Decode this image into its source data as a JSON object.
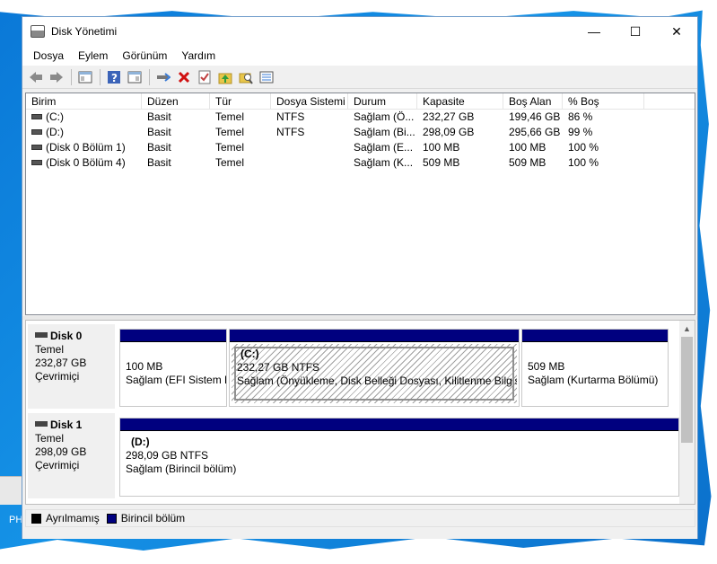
{
  "window": {
    "title": "Disk Yönetimi",
    "controls": {
      "minimize": "—",
      "maximize": "☐",
      "close": "✕"
    }
  },
  "menu": [
    "Dosya",
    "Eylem",
    "Görünüm",
    "Yardım"
  ],
  "toolbar_icons": [
    "back-arrow-icon",
    "forward-arrow-icon",
    "show-hide-tree-icon",
    "help-icon",
    "properties-icon",
    "connect-icon",
    "delete-icon",
    "check-icon",
    "up-folder-icon",
    "search-folder-icon",
    "list-view-icon"
  ],
  "volumes": {
    "headers": [
      "Birim",
      "Düzen",
      "Tür",
      "Dosya Sistemi",
      "Durum",
      "Kapasite",
      "Boş Alan",
      "% Boş"
    ],
    "rows": [
      [
        "(C:)",
        "Basit",
        "Temel",
        "NTFS",
        "Sağlam (Ö...",
        "232,27 GB",
        "199,46 GB",
        "86 %"
      ],
      [
        "(D:)",
        "Basit",
        "Temel",
        "NTFS",
        "Sağlam (Bi...",
        "298,09 GB",
        "295,66 GB",
        "99 %"
      ],
      [
        "(Disk 0 Bölüm 1)",
        "Basit",
        "Temel",
        "",
        "Sağlam (E...",
        "100 MB",
        "100 MB",
        "100 %"
      ],
      [
        "(Disk 0 Bölüm 4)",
        "Basit",
        "Temel",
        "",
        "Sağlam (K...",
        "509 MB",
        "509 MB",
        "100 %"
      ]
    ]
  },
  "disks": [
    {
      "name": "Disk 0",
      "type": "Temel",
      "size": "232,87 GB",
      "status": "Çevrimiçi",
      "partitions": [
        {
          "label": "",
          "size": "100 MB",
          "status": "Sağlam (EFI Sistem Bölümü)"
        },
        {
          "label": "(C:)",
          "size": "232,27 GB NTFS",
          "status": "Sağlam (Önyükleme, Disk Belleği Dosyası, Kilitlenme Bilgisi, Birincil Bölüm)"
        },
        {
          "label": "",
          "size": "509 MB",
          "status": "Sağlam (Kurtarma Bölümü)"
        }
      ]
    },
    {
      "name": "Disk 1",
      "type": "Temel",
      "size": "298,09 GB",
      "status": "Çevrimiçi",
      "partitions": [
        {
          "label": "(D:)",
          "size": "298,09 GB NTFS",
          "status": "Sağlam (Birincil bölüm)"
        }
      ]
    }
  ],
  "legend": [
    {
      "label": "Ayrılmamış",
      "color": "#000000"
    },
    {
      "label": "Birincil bölüm",
      "color": "#00007f"
    }
  ],
  "desktop_fragment": "PH"
}
